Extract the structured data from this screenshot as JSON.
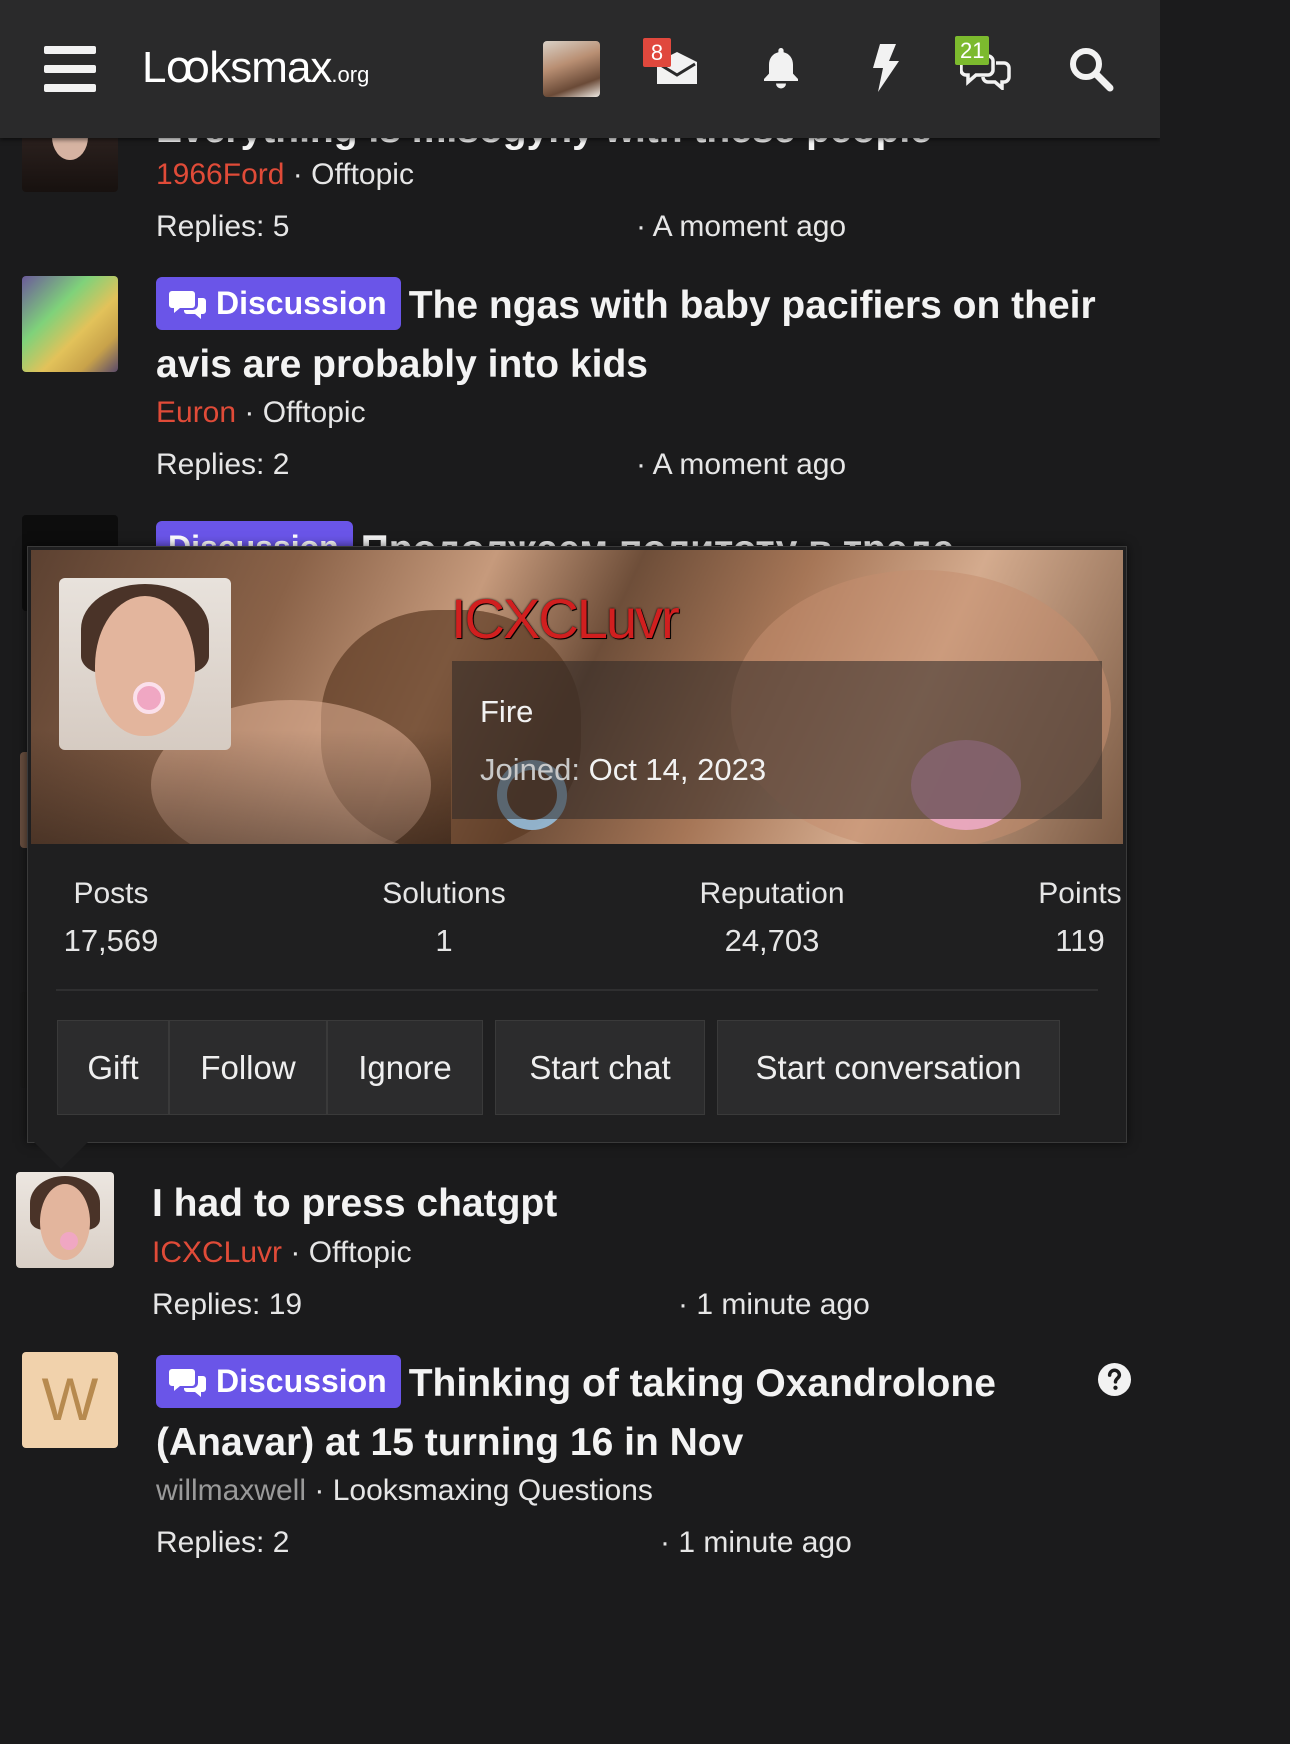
{
  "header": {
    "logo_main": "Lꝏksmax",
    "logo_tld": ".org",
    "conversations_badge": "8",
    "chat_badge": "21"
  },
  "threads": [
    {
      "title_partial": "Everything is misogyny with these people",
      "author": "1966Ford",
      "forum": "Offtopic",
      "replies": "Replies: 5",
      "time": "· A moment ago"
    },
    {
      "prefix": "Discussion",
      "title": "The ngas with baby pacifiers on their avis are probably into kids",
      "author": "Euron",
      "forum": "Offtopic",
      "replies": "Replies: 2",
      "time": "· A moment ago"
    },
    {
      "prefix": "Discussion",
      "title_partial": "Продолжаем политоту в треде"
    },
    {
      "title": "I had to press chatgpt",
      "author": "ICXCLuvr",
      "forum": "Offtopic",
      "replies": "Replies: 19",
      "time": "· 1 minute ago"
    },
    {
      "prefix": "Discussion",
      "title": "Thinking of taking Oxandrolone (Anavar) at 15 turning 16 in Nov",
      "author": "willmaxwell",
      "forum": "Looksmaxing Questions",
      "replies": "Replies: 2",
      "time": "· 1 minute ago",
      "avatar_letter": "W"
    }
  ],
  "sep": "·",
  "popup": {
    "username": "ICXCLuvr",
    "user_title": "Fire",
    "joined_label": "Joined:",
    "joined_date": "Oct 14, 2023",
    "stats": [
      {
        "label": "Posts",
        "value": "17,569"
      },
      {
        "label": "Solutions",
        "value": "1"
      },
      {
        "label": "Reputation",
        "value": "24,703"
      },
      {
        "label": "Points",
        "value": "119"
      }
    ],
    "buttons": [
      "Gift",
      "Follow",
      "Ignore",
      "Start chat",
      "Start conversation"
    ]
  },
  "colors": {
    "background": "#1b1b1c",
    "header": "#2a2a2b",
    "prefix": "#6a55e8",
    "username": "#e04b38",
    "badge_red": "#e0483d",
    "badge_green": "#7cba2e"
  }
}
